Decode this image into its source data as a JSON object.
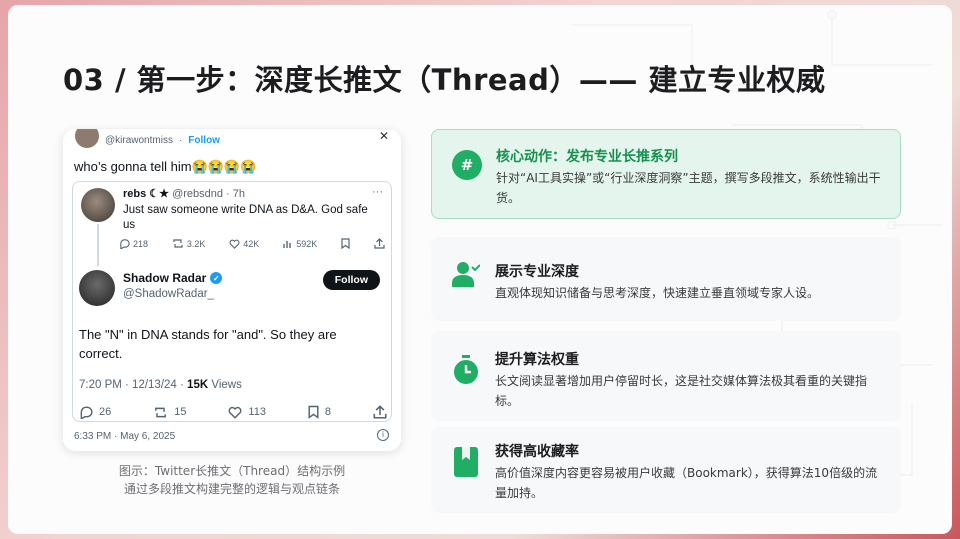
{
  "title": "03 / 第一步：深度长推文（Thread）—— 建立专业权威",
  "tweet": {
    "top_handle": "@kirawontmiss",
    "top_follow": "Follow",
    "top_text": "who’s gonna tell him😭😭😭😭",
    "quote": {
      "name": "rebs ☾★",
      "handle_time": "@rebsdnd · 7h",
      "body": "Just saw someone write DNA as D&A. God safe us",
      "replies": "218",
      "retweets": "3.2K",
      "likes": "42K",
      "views": "592K"
    },
    "reply": {
      "name": "Shadow Radar",
      "handle": "@ShadowRadar_",
      "follow": "Follow",
      "text": "The \"N\" in DNA stands for \"and\". So they are correct.",
      "time": "7:20 PM · 12/13/24 · ",
      "views_count": "15K",
      "views_label": " Views",
      "replies": "26",
      "retweets": "15",
      "likes": "113",
      "bookmarks": "8"
    },
    "date": "6:33 PM · May 6, 2025"
  },
  "caption": {
    "line1": "图示：Twitter长推文（Thread）结构示例",
    "line2": "通过多段推文构建完整的逻辑与观点链条"
  },
  "cards": [
    {
      "icon": "hashtag-icon",
      "title": "核心动作：发布专业长推系列",
      "desc": "针对“AI工具实操”或“行业深度洞察”主题，撰写多段推文，系统性输出干货。"
    },
    {
      "icon": "user-check-icon",
      "title": "展示专业深度",
      "desc": "直观体现知识储备与思考深度，快速建立垂直领域专家人设。"
    },
    {
      "icon": "stopwatch-icon",
      "title": "提升算法权重",
      "desc": "长文阅读显著增加用户停留时长，这是社交媒体算法极其看重的关键指标。"
    },
    {
      "icon": "bookmark-icon",
      "title": "获得高收藏率",
      "desc": "高价值深度内容更容易被用户收藏（Bookmark），获得算法10倍级的流量加持。"
    }
  ],
  "colors": {
    "accent_green": "#1fae63",
    "highlight_bg": "#e4f5ed",
    "title": "#1d1d1f"
  }
}
